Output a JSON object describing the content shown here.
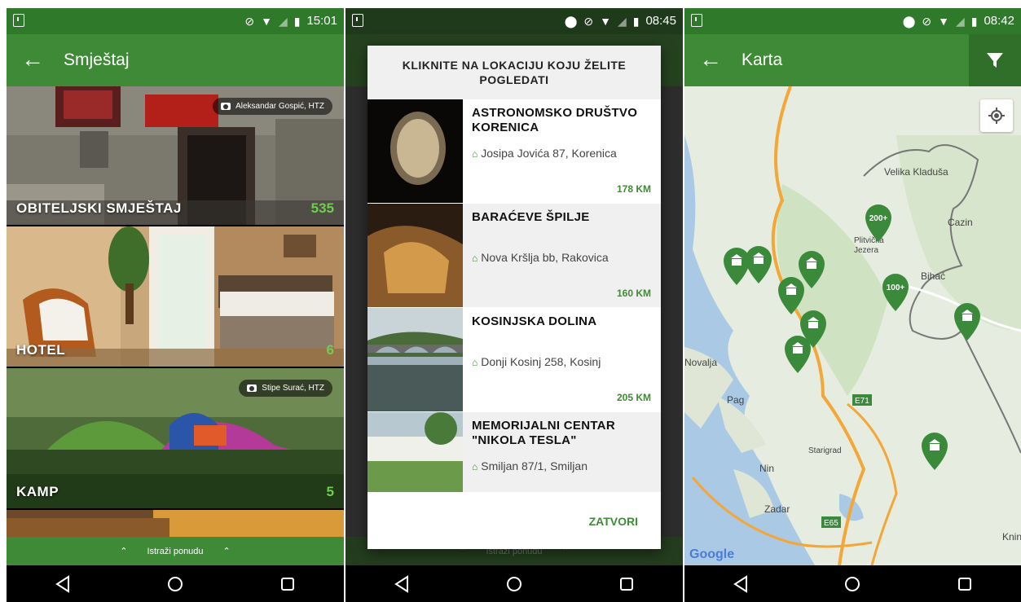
{
  "screens": {
    "accommodation": {
      "status_time": "15:01",
      "title": "Smještaj",
      "categories": [
        {
          "label": "OBITELJSKI SMJEŠTAJ",
          "count": "535",
          "credit": "Aleksandar Gospić, HTZ"
        },
        {
          "label": "HOTEL",
          "count": "6"
        },
        {
          "label": "KAMP",
          "count": "5",
          "credit": "Stipe Surać, HTZ"
        }
      ],
      "explore_label": "Istraži ponudu"
    },
    "location_dialog": {
      "status_time": "08:45",
      "title": "KLIKNITE NA LOKACIJU KOJU ŽELITE POGLEDATI",
      "locations": [
        {
          "name": "ASTRONOMSKO DRUŠTVO KORENICA",
          "address": "Josipa Jovića 87, Korenica",
          "distance": "178 KM"
        },
        {
          "name": "BARAĆEVE ŠPILJE",
          "address": "Nova Kršlja bb, Rakovica",
          "distance": "160 KM"
        },
        {
          "name": "KOSINJSKA DOLINA",
          "address": "Donji Kosinj 258, Kosinj",
          "distance": "205 KM"
        },
        {
          "name": "MEMORIJALNI CENTAR \"NIKOLA TESLA\"",
          "address": "Smiljan 87/1, Smiljan",
          "distance": ""
        }
      ],
      "close_label": "ZATVORI",
      "background_explore": "Istraži ponudu"
    },
    "map": {
      "status_time": "08:42",
      "title": "Karta",
      "places": [
        "Velika Kladuša",
        "Cazin",
        "Plitvička Jezera",
        "Bihać",
        "Novalja",
        "Pag",
        "Starigrad",
        "Nin",
        "Zadar",
        "Knin"
      ],
      "roads": [
        "E71",
        "E65"
      ],
      "clusters": [
        "200+",
        "100+"
      ],
      "google_label": "Google"
    }
  },
  "colors": {
    "primary": "#3f8a37",
    "primary_dark": "#2f7a2a",
    "accent": "#6fcf4d"
  }
}
